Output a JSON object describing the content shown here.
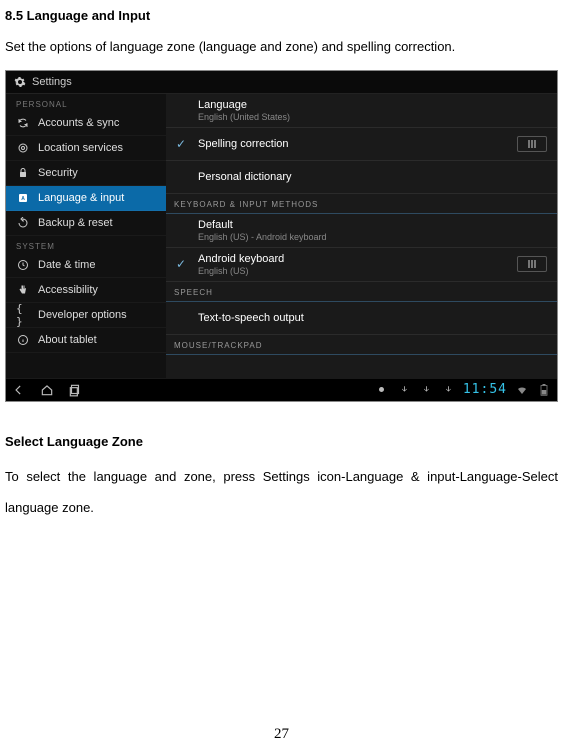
{
  "doc": {
    "heading": "8.5 Language and Input",
    "intro": "Set the options of language zone (language and zone) and spelling correction.",
    "subheading": "Select Language Zone",
    "para": "To select the language and zone, press Settings icon-Language & input-Language-Select language zone.",
    "page_number": "27"
  },
  "screenshot": {
    "header_title": "Settings",
    "sidebar": {
      "section_personal": "PERSONAL",
      "section_system": "SYSTEM",
      "items": {
        "accounts": "Accounts & sync",
        "location": "Location services",
        "security": "Security",
        "language": "Language & input",
        "backup": "Backup & reset",
        "date": "Date & time",
        "accessibility": "Accessibility",
        "developer": "Developer options",
        "about": "About tablet"
      }
    },
    "main": {
      "language_title": "Language",
      "language_sub": "English (United States)",
      "spelling_title": "Spelling correction",
      "personal_dict_title": "Personal dictionary",
      "section_keyboard": "KEYBOARD & INPUT METHODS",
      "default_title": "Default",
      "default_sub": "English (US) - Android keyboard",
      "android_kb_title": "Android keyboard",
      "android_kb_sub": "English (US)",
      "section_speech": "SPEECH",
      "tts_title": "Text-to-speech output",
      "section_mouse": "MOUSE/TRACKPAD"
    },
    "navbar": {
      "time": "11:54"
    }
  }
}
